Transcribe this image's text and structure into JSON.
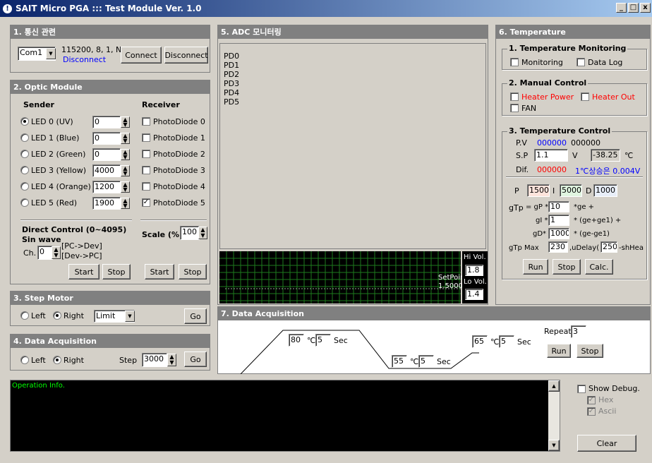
{
  "window": {
    "title": "SAIT Micro PGA ::: Test Module Ver. 1.0",
    "icon": "info-icon",
    "min": "_",
    "max": "□",
    "close": "x"
  },
  "comm": {
    "header": "1. 통신 관련",
    "port": "Com1",
    "settings": "115200, 8, 1, N",
    "status": "Disconnect",
    "connect": "Connect",
    "disconnect": "Disconnect"
  },
  "optic": {
    "header": "2. Optic Module",
    "sender_label": "Sender",
    "receiver_label": "Receiver",
    "leds": [
      {
        "label": "LED 0 (UV)",
        "value": "0",
        "selected": true
      },
      {
        "label": "LED 1 (Blue)",
        "value": "0",
        "selected": false
      },
      {
        "label": "LED 2 (Green)",
        "value": "0",
        "selected": false
      },
      {
        "label": "LED 3 (Yellow)",
        "value": "4000",
        "selected": false
      },
      {
        "label": "LED 4 (Orange)",
        "value": "1200",
        "selected": false
      },
      {
        "label": "LED 5 (Red)",
        "value": "1900",
        "selected": false
      }
    ],
    "photodiodes": [
      {
        "label": "PhotoDiode 0",
        "checked": false
      },
      {
        "label": "PhotoDiode 1",
        "checked": false
      },
      {
        "label": "PhotoDiode 2",
        "checked": false
      },
      {
        "label": "PhotoDiode 3",
        "checked": false
      },
      {
        "label": "PhotoDiode 4",
        "checked": false
      },
      {
        "label": "PhotoDiode 5",
        "checked": true
      }
    ],
    "direct_label": "Direct Control (0~4095)",
    "sin_label": "Sin wave",
    "ch_label": "Ch.",
    "ch_value": "0",
    "pc_dev": "[PC->Dev]",
    "dev_pc": "[Dev->PC]",
    "scale_label": "Scale (%)",
    "scale_value": "100",
    "start": "Start",
    "stop": "Stop"
  },
  "step": {
    "header": "3. Step Motor",
    "left": "Left",
    "right": "Right",
    "mode": "Limit",
    "go": "Go"
  },
  "daq_left": {
    "header": "4. Data Acquisition",
    "left": "Left",
    "right": "Right",
    "step_label": "Step",
    "step_value": "3000",
    "go": "Go"
  },
  "adc": {
    "header": "5. ADC 모니터링",
    "channels": [
      "PD0",
      "PD1",
      "PD2",
      "PD3",
      "PD4",
      "PD5"
    ],
    "setpoint_label": "SetPoint",
    "setpoint_value": "1.5000",
    "hi_label": "Hi Vol.",
    "hi_value": "1.8",
    "lo_label": "Lo Vol.",
    "lo_value": "1.4",
    "grid_color": "#1e7a1e"
  },
  "temp": {
    "header": "6. Temperature",
    "monitoring_title": "1. Temperature Monitoring",
    "monitoring": "Monitoring",
    "datalog": "Data Log",
    "manual_title": "2. Manual Control",
    "heater_power": "Heater Power",
    "heater_out": "Heater Out",
    "fan": "FAN",
    "control_title": "3. Temperature Control",
    "pv_label": "P.V",
    "pv_value": "000000",
    "pv_value2": "000000",
    "sp_label": "S.P",
    "sp_value": "1.1",
    "sp_unit": "V",
    "sp_temp": "-38.25",
    "sp_temp_unit": "℃",
    "dif_label": "Dif.",
    "dif_value": "000000",
    "dif_note": "1℃상승은 0.004V",
    "p_label": "P",
    "p_value": "1500",
    "i_label": "I",
    "i_value": "5000",
    "d_label": "D",
    "d_value": "1000",
    "gtp_label": "gTp",
    "gp_label": "= gP *",
    "gp_value": "10",
    "gp_suffix": "*ge +",
    "gi_label": "gI *",
    "gi_value": "1",
    "gi_suffix": "* (ge+ge1) +",
    "gd_label": "gD*",
    "gd_value": "1000",
    "gd_suffix": "* (ge-ge1)",
    "max_label": "gTp  Max",
    "max_value": "230",
    "udelay_label": ",uDelay(",
    "udelay_value": "250",
    "udelay_suffix": "-shHea",
    "run": "Run",
    "stop": "Stop",
    "calc": "Calc."
  },
  "daq": {
    "header": "7. Data Acquisition",
    "step1_temp": "80",
    "step1_time": "5",
    "step2_temp": "55",
    "step2_time": "5",
    "step3_temp": "65",
    "step3_time": "5",
    "deg": "℃",
    "sec": "Sec",
    "repeat_label": "Repeat",
    "repeat_value": "3",
    "run": "Run",
    "stop": "Stop"
  },
  "log": {
    "text": "Operation Info.",
    "show_debug": "Show Debug.",
    "hex": "Hex",
    "ascii": "Ascii",
    "clear": "Clear"
  },
  "colors": {
    "title_start": "#0a246a",
    "title_end": "#a6caf0",
    "section_header": "#808080",
    "log_text": "#00ff00"
  }
}
